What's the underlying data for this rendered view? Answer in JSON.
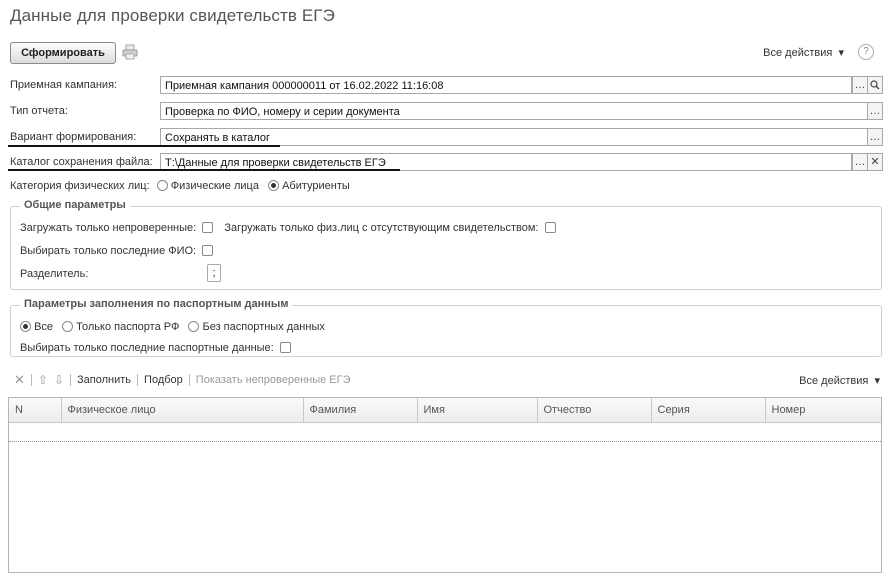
{
  "window": {
    "title": "Данные для проверки свидетельств ЕГЭ"
  },
  "toolbar": {
    "generate_label": "Сформировать",
    "all_actions": "Все действия",
    "help": "?"
  },
  "form": {
    "campaign": {
      "label": "Приемная кампания:",
      "value": "Приемная кампания 000000011 от 16.02.2022 11:16:08"
    },
    "report_type": {
      "label": "Тип отчета:",
      "value": "Проверка по ФИО, номеру и серии документа"
    },
    "variant": {
      "label": "Вариант формирования:",
      "value": "Сохранять в каталог"
    },
    "directory": {
      "label": "Каталог сохранения файла:",
      "value": "Т:\\Данные для проверки свидетельств ЕГЭ"
    },
    "category": {
      "label": "Категория физических лиц:",
      "options": [
        "Физические лица",
        "Абитуриенты"
      ],
      "selected": "Абитуриенты"
    }
  },
  "common_params": {
    "title": "Общие параметры",
    "only_unchecked": "Загружать только непроверенные:",
    "only_missing": "Загружать только физ.лиц с отсутствующим свидетельством:",
    "only_last_fio": "Выбирать только последние ФИО:",
    "separator_label": "Разделитель:",
    "separator_value": ";"
  },
  "passport_params": {
    "title": "Параметры заполнения по паспортным данным",
    "options": [
      "Все",
      "Только паспорта РФ",
      "Без паспортных данных"
    ],
    "selected": "Все",
    "only_last_passport": "Выбирать только последние паспортные данные:"
  },
  "table_toolbar": {
    "fill": "Заполнить",
    "select": "Подбор",
    "show_unchecked": "Показать непроверенные ЕГЭ",
    "all_actions": "Все действия"
  },
  "table": {
    "columns": [
      "N",
      "Физическое лицо",
      "Фамилия",
      "Имя",
      "Отчество",
      "Серия",
      "Номер"
    ]
  }
}
